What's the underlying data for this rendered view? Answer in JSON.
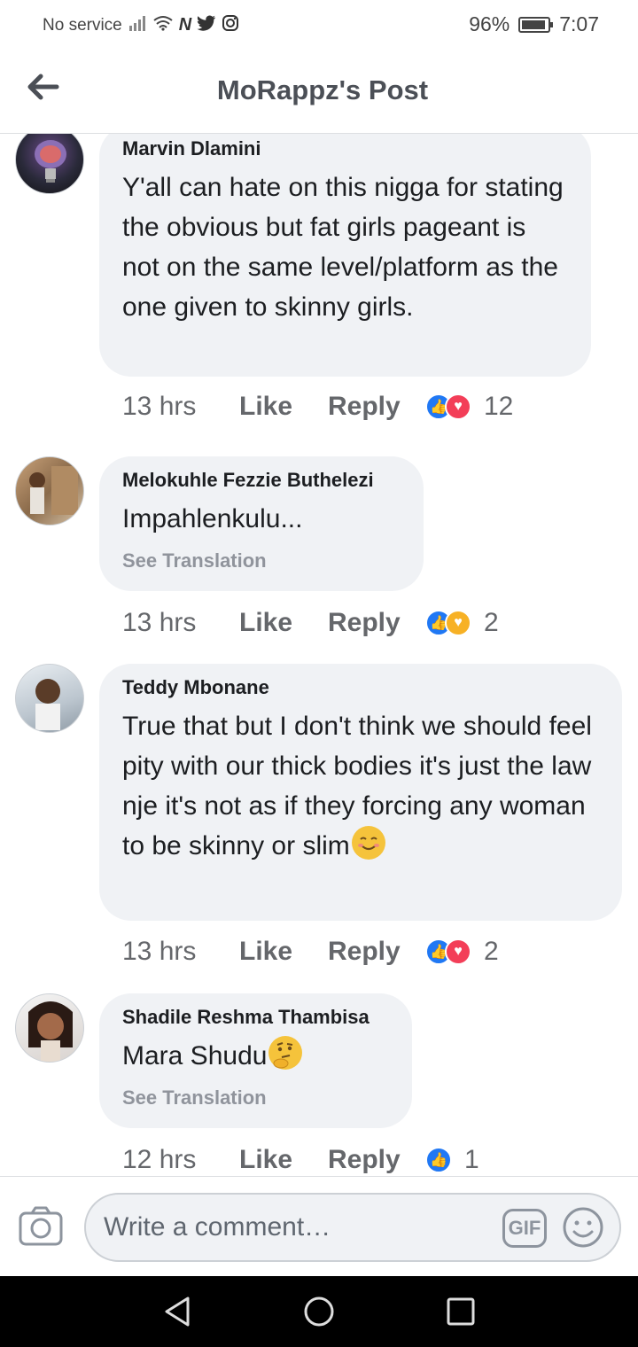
{
  "status_bar": {
    "carrier": "No service",
    "battery": "96%",
    "time": "7:07"
  },
  "header": {
    "title": "MoRappz's Post"
  },
  "comments": [
    {
      "author": "Marvin Dlamini",
      "text": "Y'all can hate on this nigga for stating the obvious but fat girls pageant is not on the same level/platform as the one given to skinny girls.",
      "time": "13 hrs",
      "like": "Like",
      "reply": "Reply",
      "reaction_count": "12",
      "reactions": [
        "like-icon",
        "love-icon"
      ]
    },
    {
      "author": "Melokuhle Fezzie Buthelezi",
      "text": "Impahlenkulu...",
      "see_translation": "See Translation",
      "time": "13 hrs",
      "like": "Like",
      "reply": "Reply",
      "reaction_count": "2",
      "reactions": [
        "like-icon",
        "care-icon"
      ]
    },
    {
      "author": "Teddy Mbonane",
      "text": "True that but I don't think we should feel pity with our thick bodies it's just the law nje it's not as if they forcing any woman to be skinny or slim",
      "time": "13 hrs",
      "like": "Like",
      "reply": "Reply",
      "reaction_count": "2",
      "reactions": [
        "like-icon",
        "love-icon"
      ]
    },
    {
      "author": "Shadile Reshma Thambisa",
      "text": "Mara Shudu",
      "see_translation": "See Translation",
      "time": "12 hrs",
      "like": "Like",
      "reply": "Reply",
      "reaction_count": "1",
      "reactions": [
        "like-icon"
      ]
    }
  ],
  "composer": {
    "placeholder": "Write a comment…",
    "gif_label": "GIF"
  }
}
